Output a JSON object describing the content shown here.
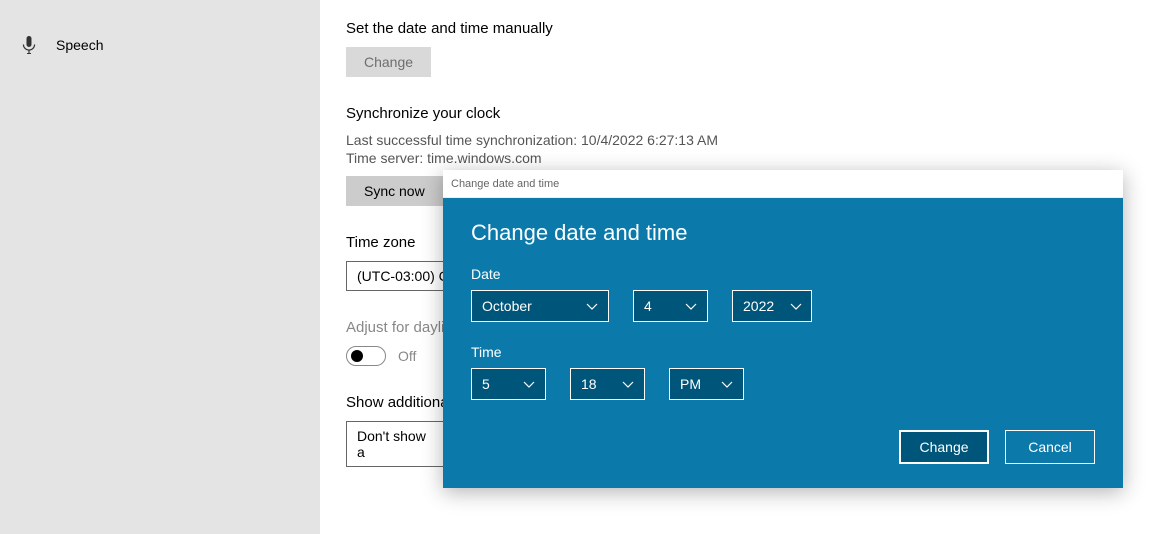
{
  "sidebar": {
    "items": [
      {
        "label": "Speech"
      }
    ]
  },
  "main": {
    "manual": {
      "title": "Set the date and time manually",
      "change_label": "Change"
    },
    "sync": {
      "title": "Synchronize your clock",
      "last_sync": "Last successful time synchronization: 10/4/2022 6:27:13 AM",
      "server": "Time server: time.windows.com",
      "sync_now_label": "Sync now"
    },
    "timezone": {
      "title": "Time zone",
      "value": "(UTC-03:00) C"
    },
    "daylight": {
      "title": "Adjust for dayli",
      "state": "Off"
    },
    "additional": {
      "title": "Show additiona",
      "value": "Don't show a"
    }
  },
  "dialog": {
    "titlebar": "Change date and time",
    "heading": "Change date and time",
    "date_label": "Date",
    "month": "October",
    "day": "4",
    "year": "2022",
    "time_label": "Time",
    "hour": "5",
    "minute": "18",
    "ampm": "PM",
    "change_label": "Change",
    "cancel_label": "Cancel"
  }
}
